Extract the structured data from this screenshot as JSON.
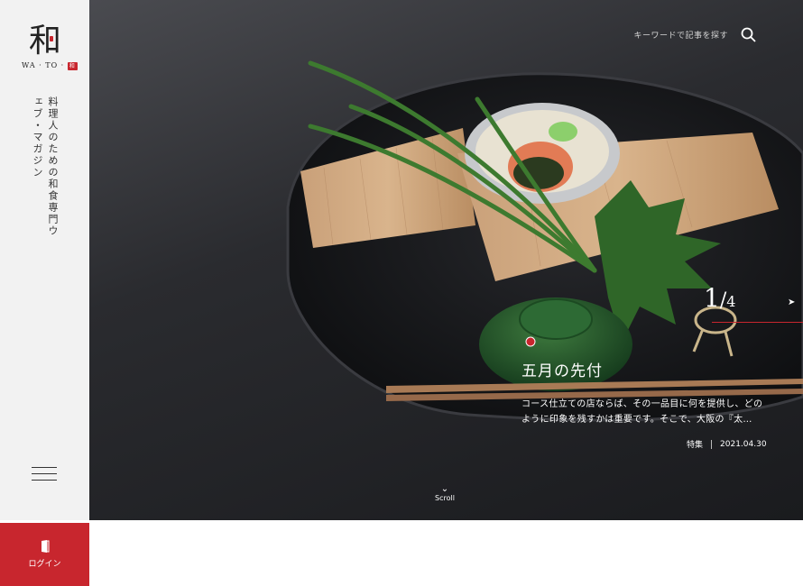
{
  "brand": {
    "logo_kanji": "和",
    "logo_roman": "WA · TO ·",
    "logo_stamp": "和",
    "tagline": "料理人のための和食専門ウェブ・マガジン"
  },
  "header": {
    "search_placeholder": "キーワードで記事を探す",
    "search_icon": "search-icon"
  },
  "slide": {
    "current": "1",
    "separator": "/",
    "total": "4",
    "title": "五月の先付",
    "excerpt": "コース仕立ての店ならば、その一品目に何を提供し、どのように印象を残すかは重要です。そこで、大阪の『太…",
    "category": "特集",
    "date": "2021.04.30"
  },
  "scroll_label": "Scroll",
  "nav": {
    "menu_icon": "hamburger-icon",
    "login_label": "ログイン",
    "login_icon": "door-icon"
  },
  "colors": {
    "accent": "#c8262e",
    "sidebar_bg": "#f2f2f2",
    "hero_bg": "#2a2b2f"
  }
}
